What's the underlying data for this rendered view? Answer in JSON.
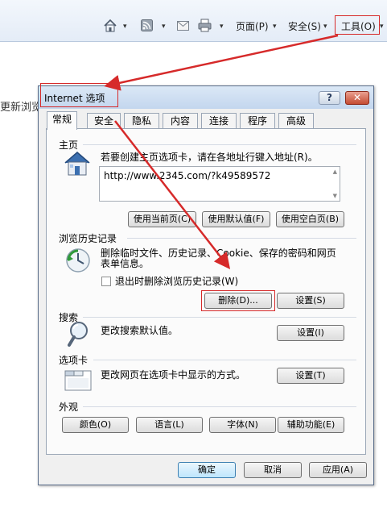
{
  "browser": {
    "toolbar": {
      "home_dropdown": "▾",
      "feeds_dropdown": "▾",
      "print_dropdown": "▾",
      "page_menu": "页面(P)",
      "safety_menu": "安全(S)",
      "tools_menu": "工具(O)",
      "dropdown_glyph": "▾"
    },
    "partial_text": "更新浏览"
  },
  "dialog": {
    "title": "Internet 选项",
    "help_button": "?",
    "close_button": "✕",
    "tabs": [
      {
        "label": "常规",
        "active": true
      },
      {
        "label": "安全"
      },
      {
        "label": "隐私"
      },
      {
        "label": "内容"
      },
      {
        "label": "连接"
      },
      {
        "label": "程序"
      },
      {
        "label": "高级"
      }
    ],
    "homepage": {
      "title": "主页",
      "description": "若要创建主页选项卡，请在各地址行键入地址(R)。",
      "url": "http://www.2345.com/?k49589572",
      "buttons": {
        "use_current": "使用当前页(C)",
        "use_default": "使用默认值(F)",
        "use_blank": "使用空白页(B)"
      }
    },
    "history": {
      "title": "浏览历史记录",
      "description_line1": "删除临时文件、历史记录、Cookie、保存的密码和网页",
      "description_line2": "表单信息。",
      "checkbox_label": "退出时删除浏览历史记录(W)",
      "checkbox_checked": false,
      "delete_button": "删除(D)...",
      "settings_button": "设置(S)"
    },
    "search": {
      "title": "搜索",
      "description": "更改搜索默认值。",
      "settings_button": "设置(I)"
    },
    "tabs_section": {
      "title": "选项卡",
      "description": "更改网页在选项卡中显示的方式。",
      "settings_button": "设置(T)"
    },
    "appearance": {
      "title": "外观",
      "buttons": {
        "colors": "颜色(O)",
        "languages": "语言(L)",
        "fonts": "字体(N)",
        "accessibility": "辅助功能(E)"
      }
    },
    "footer": {
      "ok": "确定",
      "cancel": "取消",
      "apply": "应用(A)"
    }
  },
  "colors": {
    "annotation_red": "#d62a2a",
    "title_bar": "#c3d6ee",
    "close_button": "#c44b32"
  },
  "icons": [
    "home-icon",
    "feeds-icon",
    "mail-icon",
    "print-icon",
    "house-icon",
    "history-icon",
    "magnifier-icon",
    "tabs-icon"
  ]
}
